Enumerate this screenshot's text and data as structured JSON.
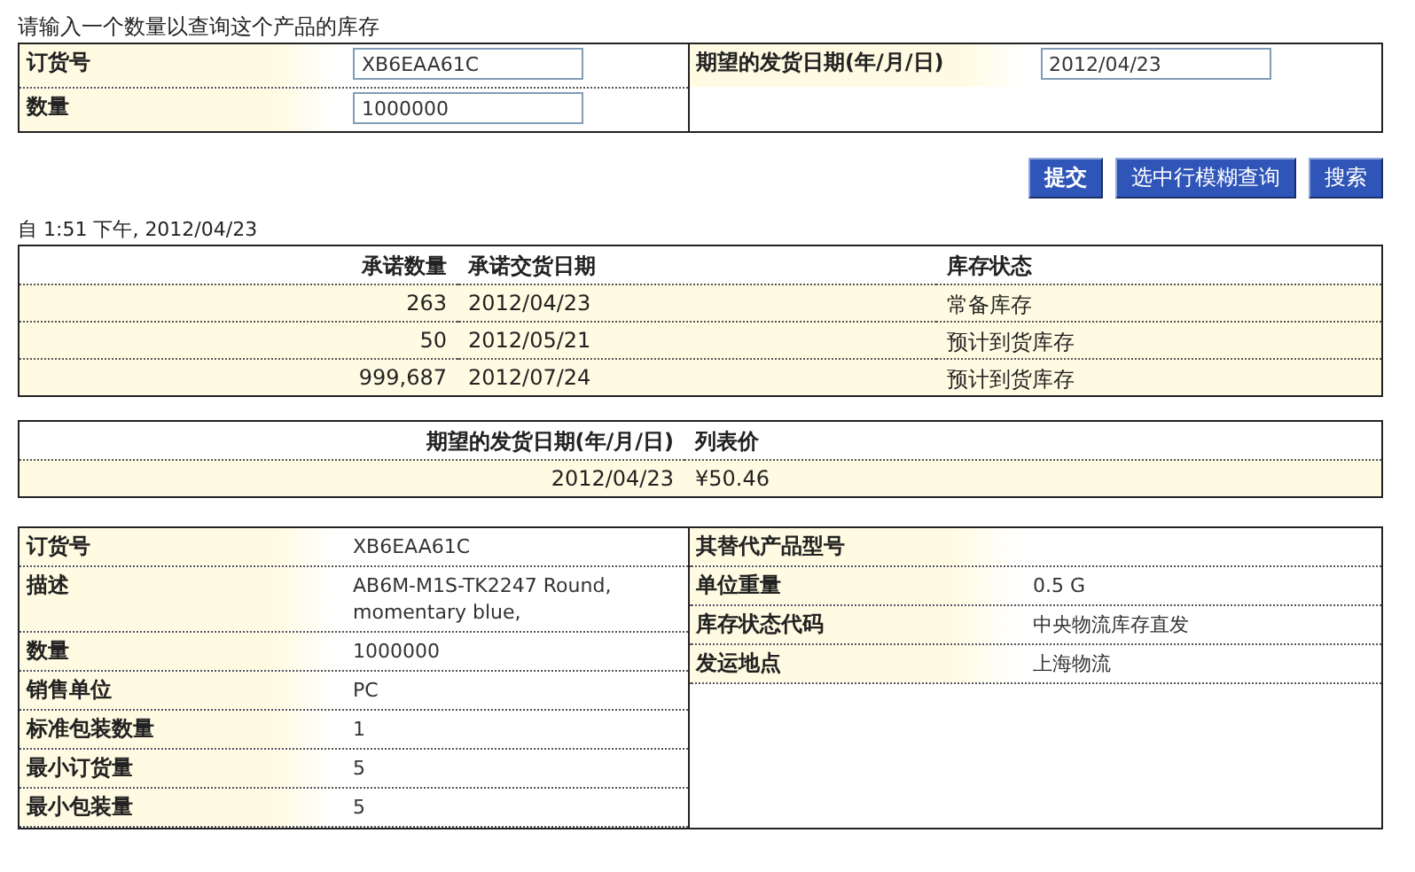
{
  "instruction": "请输入一个数量以查询这个产品的库存",
  "query": {
    "left": [
      {
        "label": "订货号",
        "value": "XB6EAA61C"
      },
      {
        "label": "数量",
        "value": "1000000"
      }
    ],
    "right": [
      {
        "label": "期望的发货日期(年/月/日)",
        "value": "2012/04/23"
      }
    ]
  },
  "buttons": [
    "提交",
    "选中行模糊查询",
    "搜索"
  ],
  "timestamp": "自 1:51 下午, 2012/04/23",
  "availability": {
    "columns": [
      "承诺数量",
      "承诺交货日期",
      "库存状态"
    ],
    "rows": [
      [
        "263",
        "2012/04/23",
        "常备库存"
      ],
      [
        "50",
        "2012/05/21",
        "预计到货库存"
      ],
      [
        "999,687",
        "2012/07/24",
        "预计到货库存"
      ]
    ]
  },
  "price": {
    "columns": [
      "期望的发货日期(年/月/日)",
      "列表价"
    ],
    "rows": [
      [
        "2012/04/23",
        "¥50.46"
      ]
    ]
  },
  "details": {
    "left": [
      {
        "label": "订货号",
        "value": "XB6EAA61C"
      },
      {
        "label": "描述",
        "value": "AB6M-M1S-TK2247 Round, momentary blue,"
      },
      {
        "label": "数量",
        "value": "1000000"
      },
      {
        "label": "销售单位",
        "value": "PC"
      },
      {
        "label": "标准包装数量",
        "value": "1"
      },
      {
        "label": "最小订货量",
        "value": "5"
      },
      {
        "label": "最小包装量",
        "value": "5"
      }
    ],
    "right": [
      {
        "label": "其替代产品型号"
      },
      {
        "label": "单位重量",
        "value": "0.5 G"
      },
      {
        "label": "库存状态代码",
        "value": "中央物流库存直发"
      },
      {
        "label": "发运地点",
        "value": "上海物流"
      }
    ]
  }
}
